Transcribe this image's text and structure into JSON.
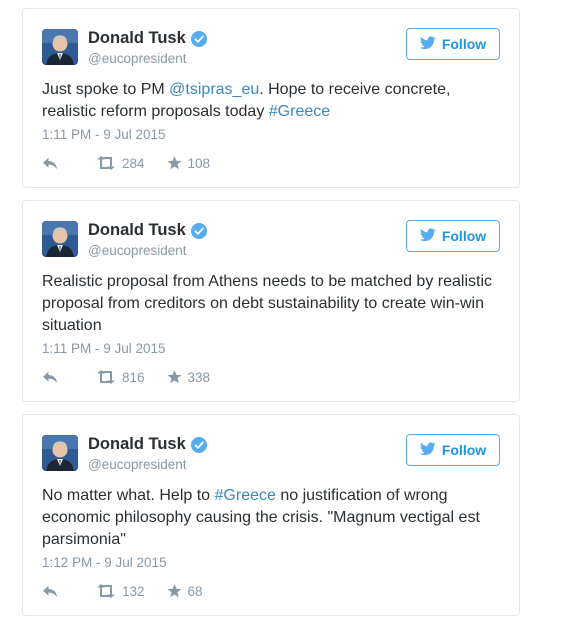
{
  "tweets": [
    {
      "name": "Donald Tusk",
      "handle": "@eucopresident",
      "follow_label": "Follow",
      "text": [
        {
          "t": "Just spoke to PM ",
          "link": false
        },
        {
          "t": "@tsipras_eu",
          "link": true
        },
        {
          "t": ". Hope to receive concrete, realistic reform proposals today ",
          "link": false
        },
        {
          "t": "#Greece",
          "link": true
        }
      ],
      "time": "1:11 PM - 9 Jul 2015",
      "retweets": "284",
      "likes": "108"
    },
    {
      "name": "Donald Tusk",
      "handle": "@eucopresident",
      "follow_label": "Follow",
      "text": [
        {
          "t": "Realistic proposal from Athens needs to be matched by realistic proposal from creditors on debt sustainability to create win-win situation",
          "link": false
        }
      ],
      "time": "1:11 PM - 9 Jul 2015",
      "retweets": "816",
      "likes": "338"
    },
    {
      "name": "Donald Tusk",
      "handle": "@eucopresident",
      "follow_label": "Follow",
      "text": [
        {
          "t": "No matter what. Help to ",
          "link": false
        },
        {
          "t": "#Greece",
          "link": true
        },
        {
          "t": " no justification of wrong economic philosophy causing the crisis. \"Magnum vectigal est parsimonia\"",
          "link": false
        }
      ],
      "time": "1:12 PM - 9 Jul 2015",
      "retweets": "132",
      "likes": "68"
    }
  ],
  "colors": {
    "accent": "#55acee",
    "link": "#3b88c3",
    "muted": "#8899a6",
    "border": "#e1e8ed",
    "text": "#292f33"
  },
  "icons": {
    "verified": "verified-badge-icon",
    "bird": "twitter-bird-icon",
    "reply": "reply-arrow-icon",
    "retweet": "retweet-icon",
    "like": "star-icon"
  }
}
